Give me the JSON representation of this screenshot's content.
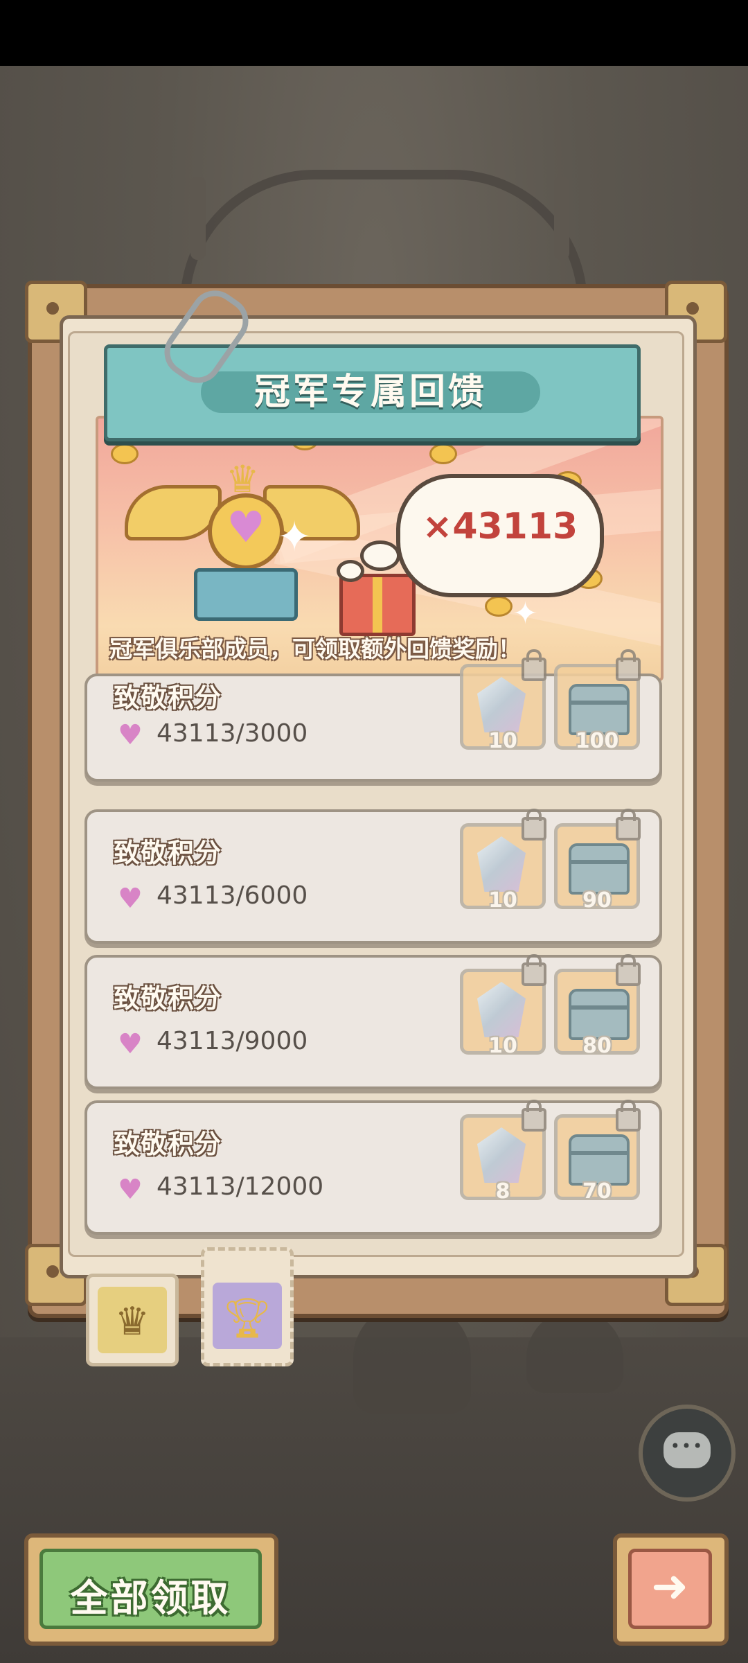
{
  "panel": {
    "title": "冠军专属回馈",
    "score_display": "×43113",
    "caption": "冠军俱乐部成员，可领取额外回馈奖励！"
  },
  "rewards": [
    {
      "label": "致敬积分",
      "progress": "43113/3000",
      "gem_qty": "10",
      "chest_qty": "100",
      "locked": true
    },
    {
      "label": "致敬积分",
      "progress": "43113/6000",
      "gem_qty": "10",
      "chest_qty": "90",
      "locked": true
    },
    {
      "label": "致敬积分",
      "progress": "43113/9000",
      "gem_qty": "10",
      "chest_qty": "80",
      "locked": true
    },
    {
      "label": "致敬积分",
      "progress": "43113/12000",
      "gem_qty": "8",
      "chest_qty": "70",
      "locked": true
    }
  ],
  "tabs": [
    {
      "icon": "crown-icon",
      "selected": false
    },
    {
      "icon": "trophy-icon",
      "selected": true
    }
  ],
  "buttons": {
    "claim_all": "全部领取",
    "next_icon": "arrow-right-icon",
    "chat_icon": "chat-bubble-icon"
  },
  "colors": {
    "header_teal": "#7fc5c2",
    "score_red": "#c2433c",
    "claim_green": "#8ec87a",
    "heart_pink": "#d884c6"
  }
}
